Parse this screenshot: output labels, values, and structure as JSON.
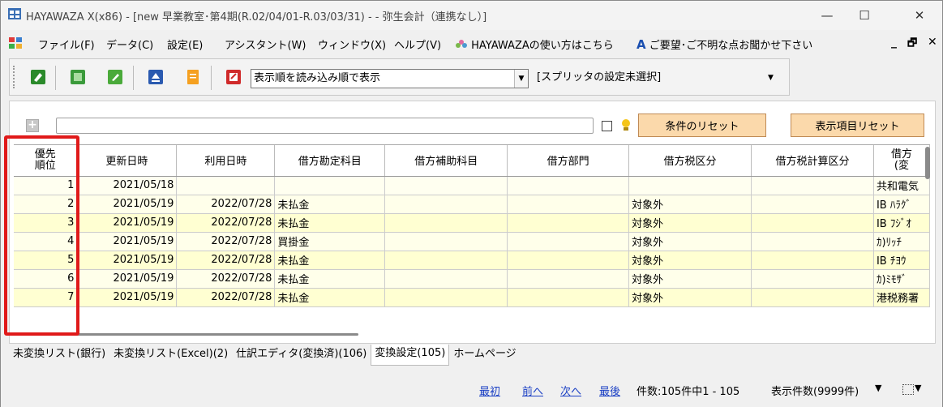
{
  "window": {
    "title": "HAYAWAZA X(x86) - [new 早業教室･第4期(R.02/04/01-R.03/03/31) - - 弥生会計（連携なし）]",
    "min_symbol": "—",
    "max_symbol": "☐",
    "close_symbol": "✕"
  },
  "menu": {
    "items": [
      "ファイル(F)",
      "データ(C)",
      "設定(E)",
      "アシスタント(W)",
      "ウィンドウ(X)",
      "ヘルプ(V)"
    ],
    "help_link": "HAYAWAZAの使い方はこちら",
    "feedback_link": "ご要望･ご不明な点お聞かせ下さい",
    "mdi_min": "_",
    "mdi_restore": "🗗",
    "mdi_close": "✕"
  },
  "toolbar": {
    "display_order": "表示順を読み込み順で表示",
    "splitter": "[スプリッタの設定未選択]",
    "dropdown_arrow": "▼"
  },
  "filter": {
    "plus": "+",
    "reset_conditions": "条件のリセット",
    "reset_columns": "表示項目リセット"
  },
  "grid": {
    "columns": [
      "優先順位",
      "更新日時",
      "利用日時",
      "借方勘定科目",
      "借方補助科目",
      "借方部門",
      "借方税区分",
      "借方税計算区分",
      "借方(変"
    ],
    "priority_header_line1": "優先",
    "priority_header_line2": "順位",
    "last_header_line1": "借方",
    "last_header_line2": "(変",
    "rows": [
      {
        "priority": "1",
        "updated": "2021/05/18",
        "used": "",
        "account": "",
        "sub": "",
        "dept": "",
        "tax": "",
        "taxcalc": "",
        "extra": "共和電気"
      },
      {
        "priority": "2",
        "updated": "2021/05/19",
        "used": "2022/07/28",
        "account": "未払金",
        "sub": "",
        "dept": "",
        "tax": "対象外",
        "taxcalc": "",
        "extra": "IB ﾊﾗｸﾞ"
      },
      {
        "priority": "3",
        "updated": "2021/05/19",
        "used": "2022/07/28",
        "account": "未払金",
        "sub": "",
        "dept": "",
        "tax": "対象外",
        "taxcalc": "",
        "extra": "IB ﾌｼﾞｵ"
      },
      {
        "priority": "4",
        "updated": "2021/05/19",
        "used": "2022/07/28",
        "account": "買掛金",
        "sub": "",
        "dept": "",
        "tax": "対象外",
        "taxcalc": "",
        "extra": "ｶ)ﾘｯﾁ"
      },
      {
        "priority": "5",
        "updated": "2021/05/19",
        "used": "2022/07/28",
        "account": "未払金",
        "sub": "",
        "dept": "",
        "tax": "対象外",
        "taxcalc": "",
        "extra": "IB ﾁﾖｳ"
      },
      {
        "priority": "6",
        "updated": "2021/05/19",
        "used": "2022/07/28",
        "account": "未払金",
        "sub": "",
        "dept": "",
        "tax": "対象外",
        "taxcalc": "",
        "extra": "ｶ)ﾐﾓｻﾞ"
      },
      {
        "priority": "7",
        "updated": "2021/05/19",
        "used": "2022/07/28",
        "account": "未払金",
        "sub": "",
        "dept": "",
        "tax": "対象外",
        "taxcalc": "",
        "extra": "港税務署"
      }
    ]
  },
  "tabs": [
    "未変換リスト(銀行)",
    "未変換リスト(Excel)(2)",
    "仕訳エディタ(変換済)(106)",
    "変換設定(105)",
    "ホームページ"
  ],
  "active_tab": 3,
  "status": {
    "first": "最初",
    "prev": "前へ",
    "next": "次へ",
    "last": "最後",
    "count": "件数:105件中1 - 105",
    "display_count": "表示件数(9999件)",
    "dd_arrow": "▼"
  },
  "colors": {
    "highlight": "#e01a1a",
    "row_fill": "#ffffd2",
    "button_fill": "#fbd9ab",
    "link": "#1a3fc4"
  }
}
